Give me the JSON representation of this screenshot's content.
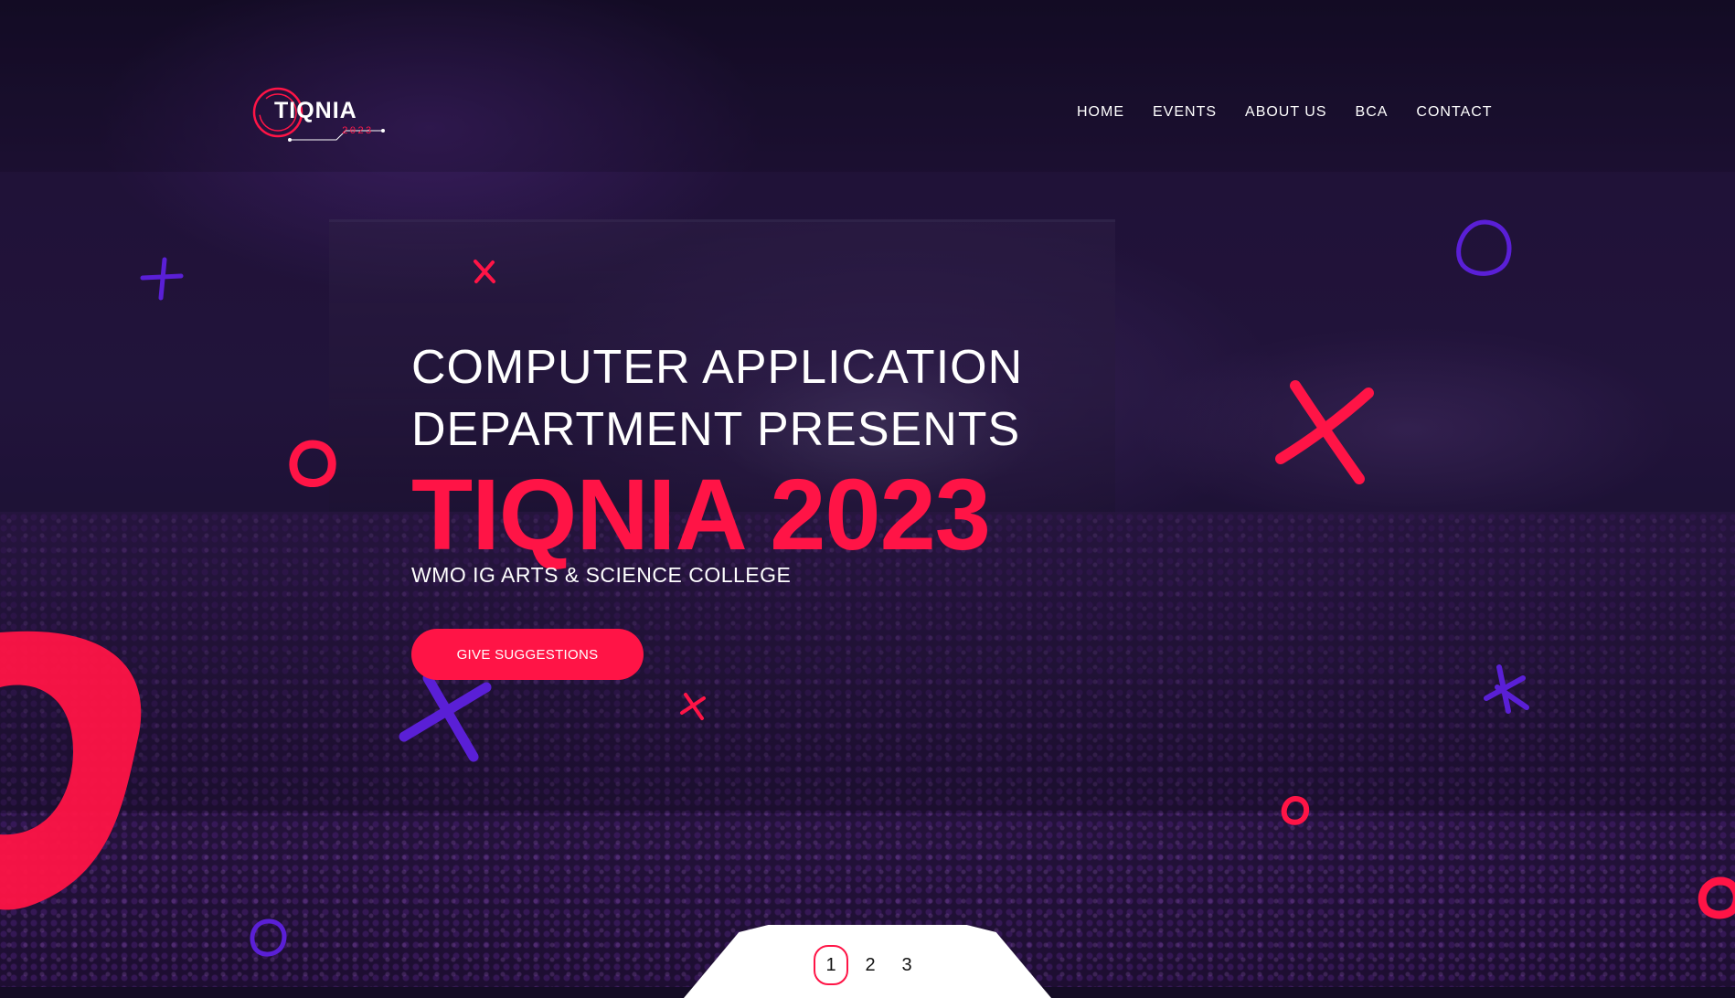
{
  "header": {
    "logo_text": "TIQNIA",
    "logo_year": "2023",
    "nav": [
      {
        "label": "HOME"
      },
      {
        "label": "EVENTS"
      },
      {
        "label": "ABOUT US"
      },
      {
        "label": "BCA"
      },
      {
        "label": "CONTACT"
      }
    ]
  },
  "hero": {
    "subtitle_line1": "COMPUTER APPLICATION",
    "subtitle_line2": "DEPARTMENT PRESENTS",
    "title": "TIQNIA 2023",
    "college": "WMO IG ARTS & SCIENCE COLLEGE",
    "cta_label": "GIVE SUGGESTIONS"
  },
  "pagination": {
    "pages": [
      "1",
      "2",
      "3"
    ],
    "active_page": "1"
  },
  "colors": {
    "accent_red": "#ff1446",
    "accent_purple": "#5a1fd6",
    "background_dark": "#140c25"
  }
}
